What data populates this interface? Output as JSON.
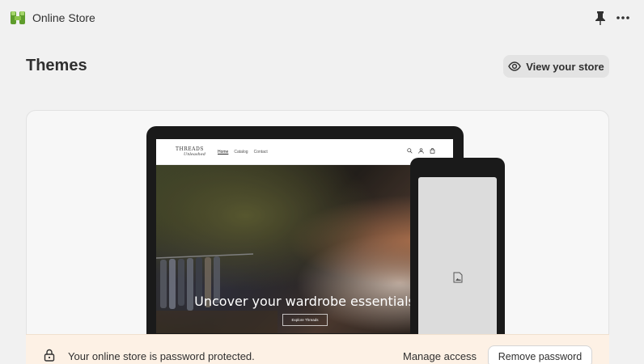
{
  "app": {
    "title": "Online Store",
    "icon": "shopify-online-store-icon",
    "accent": "#5e9c2c"
  },
  "header": {
    "pin_icon": "pin-icon",
    "more_icon": "more-horizontal-icon"
  },
  "page": {
    "title": "Themes",
    "view_store_label": "View your store",
    "view_store_icon": "eye-icon"
  },
  "preview": {
    "site_logo_line1": "THREADS",
    "site_logo_line2": "Unleashed",
    "site_nav": [
      "Home",
      "Catalog",
      "Contact"
    ],
    "hero_heading": "Uncover your wardrobe essentials",
    "hero_button": "Explore Threads",
    "tablet_placeholder_icon": "image-placeholder-icon"
  },
  "banner": {
    "message": "Your online store is password protected.",
    "manage_access_label": "Manage access",
    "remove_password_label": "Remove password",
    "background": "#fdf1e5",
    "lock_icon": "lock-icon"
  }
}
